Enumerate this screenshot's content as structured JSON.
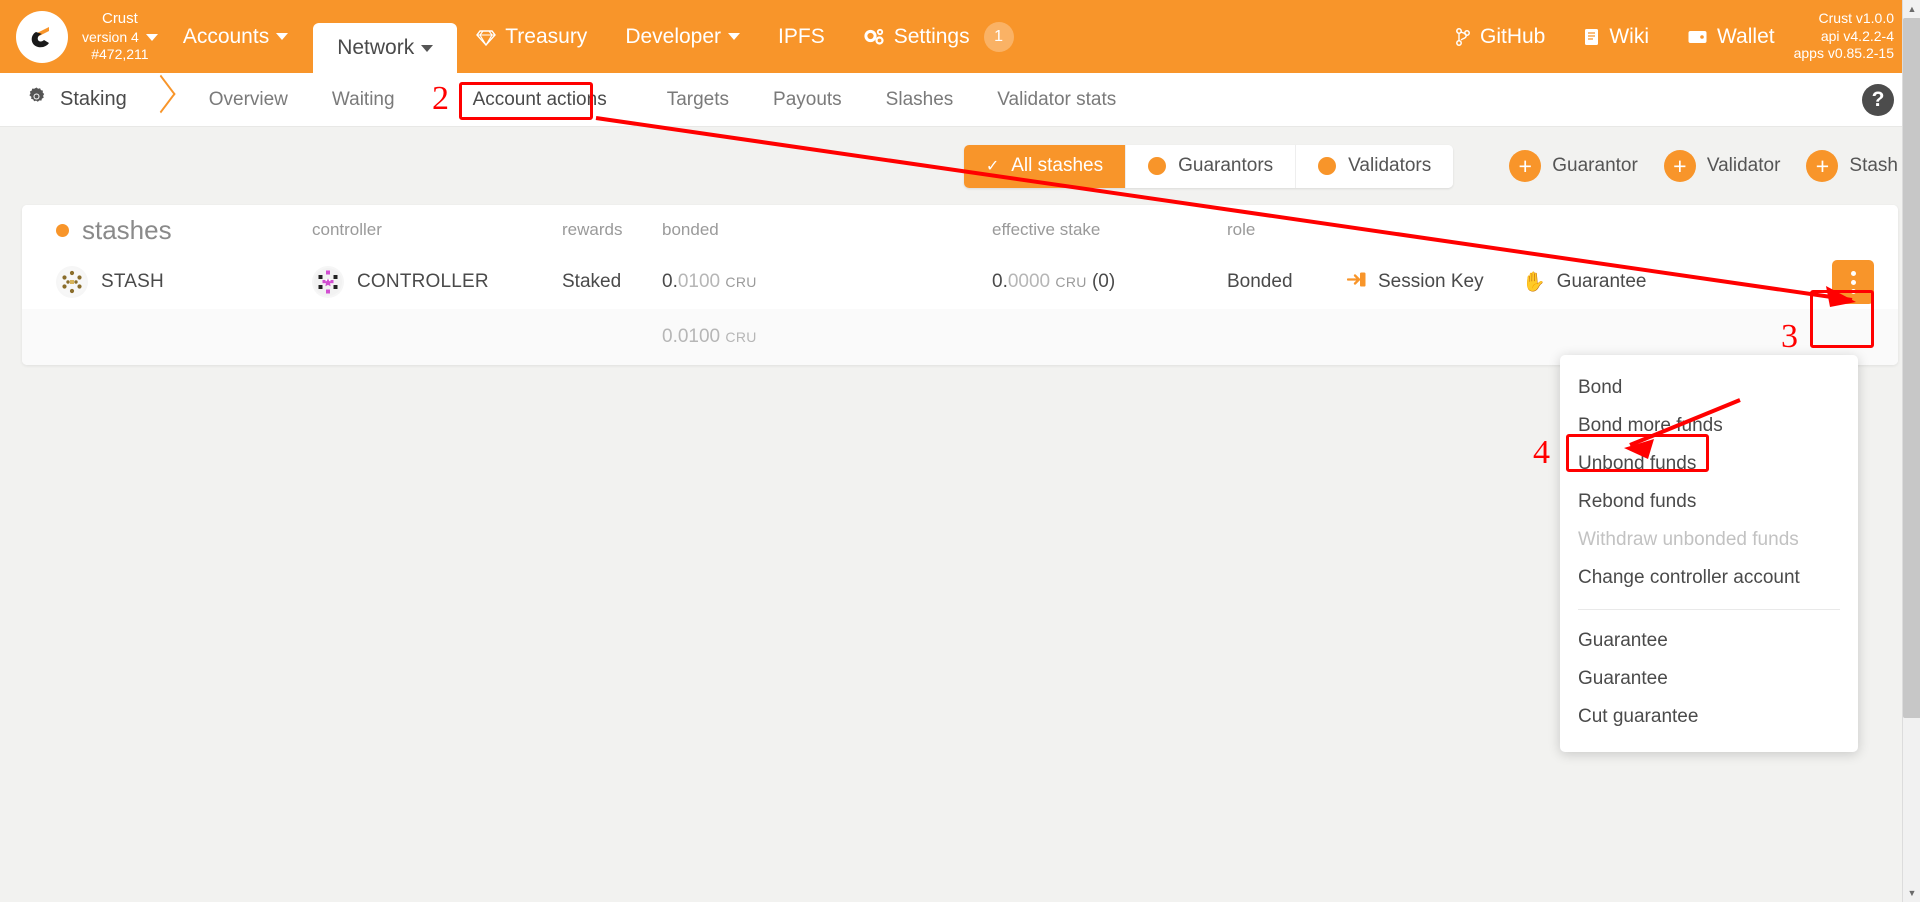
{
  "topbar": {
    "logo_icon": "crust-logo-icon",
    "brand": {
      "line1": "Crust",
      "line2": "version 4",
      "line3": "#472,211"
    },
    "nav": [
      {
        "label": "Accounts",
        "icon": "",
        "caret": true,
        "active": false
      },
      {
        "label": "Network",
        "icon": "",
        "caret": true,
        "active": true
      },
      {
        "label": "Treasury",
        "icon": "diamond-icon",
        "caret": false,
        "active": false
      },
      {
        "label": "Developer",
        "icon": "",
        "caret": true,
        "active": false
      },
      {
        "label": "IPFS",
        "icon": "",
        "caret": false,
        "active": false
      },
      {
        "label": "Settings",
        "icon": "gears-icon",
        "caret": false,
        "active": false,
        "badge": "1"
      }
    ],
    "right_links": [
      {
        "label": "GitHub",
        "icon": "git-branch-icon"
      },
      {
        "label": "Wiki",
        "icon": "book-icon"
      },
      {
        "label": "Wallet",
        "icon": "wallet-icon"
      }
    ],
    "versions": {
      "line1": "Crust v1.0.0",
      "line2": "api v4.2.2-4",
      "line3": "apps v0.85.2-15"
    }
  },
  "tabbar": {
    "section_icon": "staking-gear-icon",
    "section_title": "Staking",
    "tabs": [
      {
        "label": "Overview",
        "selected": false
      },
      {
        "label": "Waiting",
        "selected": false
      },
      {
        "label": "Account actions",
        "selected": true
      },
      {
        "label": "Targets",
        "selected": false
      },
      {
        "label": "Payouts",
        "selected": false
      },
      {
        "label": "Slashes",
        "selected": false
      },
      {
        "label": "Validator stats",
        "selected": false
      }
    ],
    "help_label": "?"
  },
  "actionrow": {
    "segments": [
      {
        "label": "All stashes",
        "selected": true
      },
      {
        "label": "Guarantors",
        "selected": false
      },
      {
        "label": "Validators",
        "selected": false
      }
    ],
    "buttons": [
      {
        "label": "Guarantor",
        "icon": "plus-icon"
      },
      {
        "label": "Validator",
        "icon": "plus-icon"
      },
      {
        "label": "Stash",
        "icon": "plus-icon"
      }
    ]
  },
  "table": {
    "headers": {
      "stashes": "stashes",
      "controller": "controller",
      "rewards": "rewards",
      "bonded": "bonded",
      "effective_stake": "effective stake",
      "role": "role"
    },
    "rows": [
      {
        "stash_name": "STASH",
        "stash_icon": "identicon",
        "controller_name": "CONTROLLER",
        "controller_icon": "identicon",
        "rewards": "Staked",
        "bonded_int": "0.",
        "bonded_dec": "0100",
        "bonded_unit": "CRU",
        "effective_int": "0.",
        "effective_dec": "0000",
        "effective_unit": "CRU",
        "effective_count": "(0)",
        "role": "Bonded",
        "session_key_label": "Session Key",
        "session_key_icon": "arrow-into-box-icon",
        "guarantee_label": "Guarantee",
        "guarantee_icon": "hand-icon",
        "menu_icon": "kebab-menu-icon"
      }
    ],
    "subrow": {
      "bonded_int": "0.",
      "bonded_dec": "0100",
      "bonded_unit": "CRU"
    }
  },
  "menu": {
    "items": [
      {
        "label": "Bond",
        "disabled": false,
        "divider_after": false
      },
      {
        "label": "Bond more funds",
        "disabled": false,
        "divider_after": false
      },
      {
        "label": "Unbond funds",
        "disabled": false,
        "divider_after": false,
        "highlighted": true
      },
      {
        "label": "Rebond funds",
        "disabled": false,
        "divider_after": false
      },
      {
        "label": "Withdraw unbonded funds",
        "disabled": true,
        "divider_after": false
      },
      {
        "label": "Change controller account",
        "disabled": false,
        "divider_after": true
      },
      {
        "label": "Guarantee",
        "disabled": false,
        "divider_after": false
      },
      {
        "label": "Guarantee",
        "disabled": false,
        "divider_after": false
      },
      {
        "label": "Cut guarantee",
        "disabled": false,
        "divider_after": false
      }
    ]
  },
  "annotations": {
    "step2": "2",
    "step3": "3",
    "step4": "4"
  },
  "colors": {
    "brand_orange": "#f8952a",
    "annotation_red": "#ff0000",
    "page_bg": "#f2f2f0",
    "text_dark": "#4a4a4a",
    "text_muted": "#9a9a9a"
  }
}
